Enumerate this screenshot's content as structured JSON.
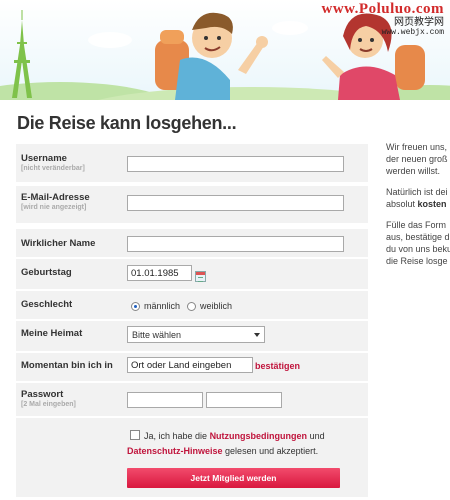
{
  "watermark": {
    "brand": "www.Poluluo.com",
    "sub": "网页教学网",
    "url": "www.webjx.com"
  },
  "page_title": "Die Reise kann losgehen...",
  "form": {
    "username_label": "Username",
    "username_hint": "[nicht veränderbar]",
    "email_label": "E-Mail-Adresse",
    "email_hint": "[wird nie angezeigt]",
    "realname_label": "Wirklicher Name",
    "birthday_label": "Geburtstag",
    "birthday_value": "01.01.1985",
    "gender_label": "Geschlecht",
    "gender_options": [
      "männlich",
      "weiblich"
    ],
    "gender_selected": "männlich",
    "home_label": "Meine Heimat",
    "home_select": "Bitte wählen",
    "location_label": "Momentan bin ich in",
    "location_value": "Ort oder Land eingeben",
    "confirm_link": "bestätigen",
    "password_label": "Passwort",
    "password_hint": "[2 Mal eingeben]",
    "terms_prefix": "Ja, ich habe die",
    "terms_link1": "Nutzungsbedingungen",
    "terms_and": "und",
    "terms_link2": "Datenschutz-Hinweise",
    "terms_suffix": "gelesen und akzeptiert.",
    "submit_label": "Jetzt Mitglied werden"
  },
  "side": {
    "p1": [
      "Wir freuen uns,",
      "der neuen groß",
      "werden willst."
    ],
    "p2_line1": "Natürlich ist dei",
    "p2_line2_a": "absolut ",
    "p2_line2_b": "kosten",
    "p3": [
      "Fülle das Form",
      "aus, bestätige d",
      "du von uns beku",
      "die Reise losge"
    ]
  },
  "colors": {
    "accent": "#c0143c",
    "button": "#e0284d",
    "panel": "#f2f2f2"
  },
  "icons": [
    "calendar-icon",
    "chevron-down-icon"
  ]
}
